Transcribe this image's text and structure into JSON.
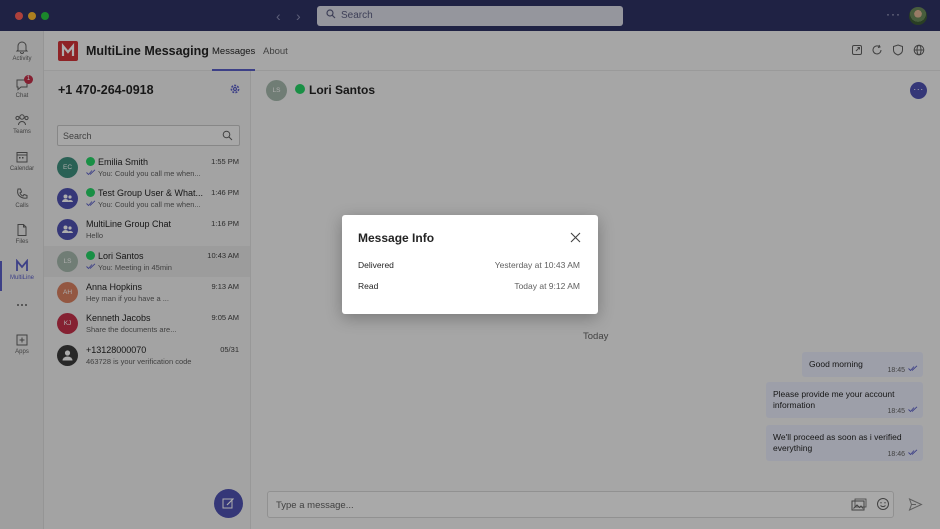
{
  "topbar": {
    "search_placeholder": "Search"
  },
  "rail": {
    "items": [
      {
        "label": "Activity",
        "icon": "bell-icon"
      },
      {
        "label": "Chat",
        "icon": "chat-icon",
        "badge": "1"
      },
      {
        "label": "Teams",
        "icon": "teams-icon"
      },
      {
        "label": "Calendar",
        "icon": "calendar-icon"
      },
      {
        "label": "Calls",
        "icon": "phone-icon"
      },
      {
        "label": "Files",
        "icon": "file-icon"
      },
      {
        "label": "MultiLine",
        "icon": "multiline-logo-icon"
      },
      {
        "label": "",
        "icon": "more-apps-icon"
      },
      {
        "label": "Apps",
        "icon": "plus-box-icon"
      }
    ]
  },
  "app": {
    "logo_letter": "M",
    "name": "MultiLine Messaging",
    "tabs": [
      {
        "label": "Messages"
      },
      {
        "label": "About"
      }
    ]
  },
  "list": {
    "line_number": "+1 470-264-0918",
    "search_placeholder": "Search",
    "conversations": [
      {
        "initials": "EC",
        "name": "Emilia Smith",
        "time": "1:55 PM",
        "preview": "You: Could you call me when...",
        "whatsapp": true,
        "color": "#3f8f7e"
      },
      {
        "initials": "",
        "name": "Test Group User & What...",
        "time": "1:46 PM",
        "preview": "You: Could you call me when...",
        "whatsapp": true,
        "color": "#4f52b2"
      },
      {
        "initials": "",
        "name": "MultiLine Group Chat",
        "time": "1:16 PM",
        "preview": "Hello",
        "whatsapp": false,
        "color": "#4f52b2"
      },
      {
        "initials": "LS",
        "name": "Lori Santos",
        "time": "10:43 AM",
        "preview": "You: Meeting in 45min",
        "whatsapp": true,
        "color": "#a6b8ad"
      },
      {
        "initials": "AH",
        "name": "Anna Hopkins",
        "time": "9:13 AM",
        "preview": "Hey man if you have a ...",
        "whatsapp": false,
        "color": "#d98060"
      },
      {
        "initials": "KJ",
        "name": "Kenneth Jacobs",
        "time": "9:05 AM",
        "preview": "Share the documents are...",
        "whatsapp": false,
        "color": "#c4314b"
      },
      {
        "initials": "",
        "name": "+13128000070",
        "time": "05/31",
        "preview": "463728 is your verification code",
        "whatsapp": false,
        "color": "#3b3b3b"
      }
    ]
  },
  "chat": {
    "contact_initials": "LS",
    "contact_name": "Lori Santos",
    "day_separator": "Today",
    "messages": [
      {
        "line1": "Good morning",
        "line2": "",
        "time": "18:45"
      },
      {
        "line1": "Please provide me your account",
        "line2": "information",
        "time": "18:45"
      },
      {
        "line1": "We'll proceed as soon as i verified",
        "line2": "everything",
        "time": "18:46"
      }
    ],
    "composer_placeholder": "Type a message..."
  },
  "modal": {
    "title": "Message Info",
    "rows": [
      {
        "label": "Delivered",
        "value": "Yesterday at 10:43 AM"
      },
      {
        "label": "Read",
        "value": "Today at 9:12 AM"
      }
    ]
  },
  "colors": {
    "titlebar": "#2f3365",
    "accent": "#5b5fc7",
    "brand_red": "#d13438",
    "whatsapp": "#25d366",
    "bubble": "#e8ebfa"
  }
}
